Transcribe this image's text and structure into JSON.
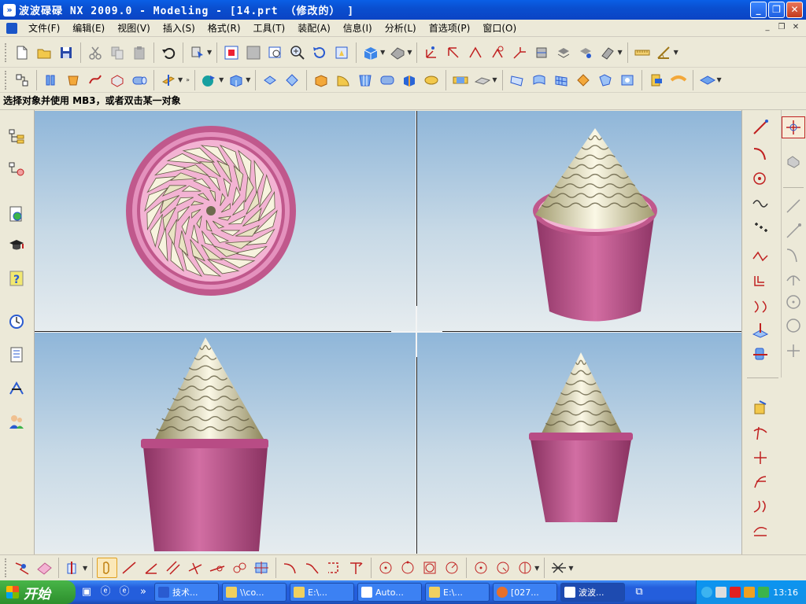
{
  "window": {
    "title": "波波碌碌 NX 2009.0 - Modeling - [14.prt （修改的） ]",
    "minimize": "_",
    "maximize": "❐",
    "close": "✕"
  },
  "menu": {
    "items": [
      "文件(F)",
      "编辑(E)",
      "视图(V)",
      "插入(S)",
      "格式(R)",
      "工具(T)",
      "装配(A)",
      "信息(I)",
      "分析(L)",
      "首选项(P)",
      "窗口(O)"
    ],
    "mdi": [
      "_",
      "❐",
      "✕"
    ]
  },
  "toolbar1": {
    "icons": [
      "new-file-icon",
      "open-folder-icon",
      "save-icon",
      "cut-icon",
      "copy-icon",
      "paste-icon",
      "undo-icon",
      "selection-icon",
      "fit-view-icon",
      "zoom-window-icon",
      "zoom-icon",
      "zoom-in-icon",
      "rotate-icon",
      "pan-icon",
      "shaded-view-icon",
      "render-style-icon",
      "datum-csys-icon",
      "datum-axis-icon",
      "datum-plane-icon",
      "point-icon",
      "wcs-icon",
      "view-orient-icon",
      "layer-icon",
      "layer-settings-icon",
      "display-icon",
      "measure-distance-icon",
      "measure-angle-icon"
    ]
  },
  "toolbar2": {
    "icons": [
      "part-navigator-icon",
      "extrude-icon",
      "revolve-icon",
      "sweep-icon",
      "tube-icon",
      "cylinder-icon",
      "datum-icon",
      "shell-icon",
      "block-icon",
      "boolean-unite-icon",
      "boolean-subtract-icon",
      "edge-blend-icon",
      "chamfer-icon",
      "draft-icon",
      "hole-icon",
      "pad-icon",
      "boss-icon",
      "pocket-icon",
      "groove-icon",
      "thread-icon",
      "face-blend-icon",
      "mesh-surface-icon",
      "through-curves-icon",
      "swept-surface-icon",
      "offset-surface-icon",
      "trim-body-icon",
      "sew-icon",
      "extract-icon",
      "mirror-icon"
    ]
  },
  "status": "选择对象并使用 MB3，或者双击某一对象",
  "left_resource_bar": [
    "assembly-navigator-icon",
    "part-navigator-icon",
    "web-browser-icon",
    "training-icon",
    "help-icon",
    "history-icon",
    "system-materials-icon",
    "process-studio-icon",
    "roles-icon"
  ],
  "right_toolbar1": [
    "line-icon",
    "arc-icon",
    "circle-icon",
    "spline-icon",
    "point-set-icon",
    "curve-fit-icon",
    "offset-curve-icon",
    "bridge-curve-icon",
    "project-curve-icon",
    "intersect-curve-icon",
    "combined-curve-icon",
    "edit-curve-icon",
    "divide-curve-icon",
    "trim-curve-icon",
    "stretch-curve-icon",
    "curve-length-icon",
    "fillet-curve-icon"
  ],
  "right_toolbar2": [
    "basic-curves-icon",
    "sketch-icon",
    "line-tool-icon",
    "polyline-icon",
    "fillet-icon",
    "arc-tool-icon",
    "circle-tool-icon",
    "point-tool-icon"
  ],
  "bottom_toolbar": [
    "snap-icon",
    "view-icon",
    "curves-menu-icon",
    "associative-icon",
    "line-icon",
    "point-icon",
    "parallel-icon",
    "perpendicular-icon",
    "tangent-icon",
    "arc-icon",
    "circle-icon",
    "rectangle-icon",
    "fillet-icon",
    "corner-icon",
    "trim-icon",
    "center-snap-icon",
    "quadrant-icon",
    "tangent-snap-icon",
    "existing-point-icon",
    "control-point-icon",
    "end-point-icon",
    "mid-point-icon",
    "delete-icon"
  ],
  "viewports": {
    "top_left": "top-view",
    "top_right": "isometric-view",
    "bottom_left": "front-view",
    "bottom_right": "right-view"
  },
  "colors": {
    "cup": "#c0588c",
    "cream": "#efeacc",
    "background_top": "#8fb6d9",
    "background_bottom": "#e6ecef"
  },
  "taskbar": {
    "start": "开始",
    "tasks": [
      "技术...",
      "\\\\co...",
      "E:\\...",
      "Auto...",
      "E:\\...",
      "[027...",
      "波波..."
    ],
    "clock": "13:16"
  }
}
